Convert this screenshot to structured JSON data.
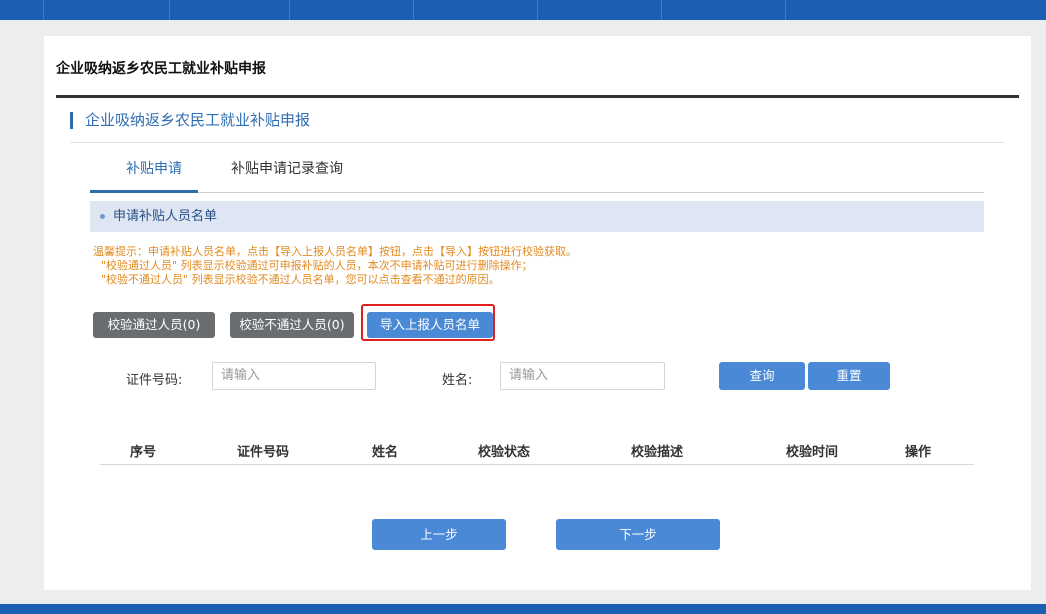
{
  "page": {
    "title": "企业吸纳返乡农民工就业补贴申报",
    "section_title": "企业吸纳返乡农民工就业补贴申报"
  },
  "tabs": [
    {
      "label": "补贴申请",
      "active": true
    },
    {
      "label": "补贴申请记录查询",
      "active": false
    }
  ],
  "subheader": {
    "label": "申请补贴人员名单"
  },
  "tips": [
    "温馨提示：申请补贴人员名单，点击【导入上报人员名单】按钮，点击【导入】按钮进行校验获取。",
    "\"校验通过人员\" 列表显示校验通过可申报补贴的人员，本次不申请补贴可进行删除操作；",
    "\"校验不通过人员\" 列表显示校验不通过人员名单，您可以点击查看不通过的原因。"
  ],
  "actions": {
    "passed": "校验通过人员(0)",
    "failed": "校验不通过人员(0)",
    "import": "导入上报人员名单"
  },
  "search": {
    "id_label": "证件号码:",
    "id_placeholder": "请输入",
    "name_label": "姓名:",
    "name_placeholder": "请输入",
    "query": "查询",
    "reset": "重置"
  },
  "table": {
    "columns": [
      "序号",
      "证件号码",
      "姓名",
      "校验状态",
      "校验描述",
      "校验时间",
      "操作"
    ],
    "rows": []
  },
  "nav": {
    "prev": "上一步",
    "next": "下一步"
  },
  "colors": {
    "brand_blue": "#1a5fb4",
    "accent_blue": "#4a89d6",
    "tip_orange": "#e28a1e",
    "highlight_red": "#e02020"
  }
}
